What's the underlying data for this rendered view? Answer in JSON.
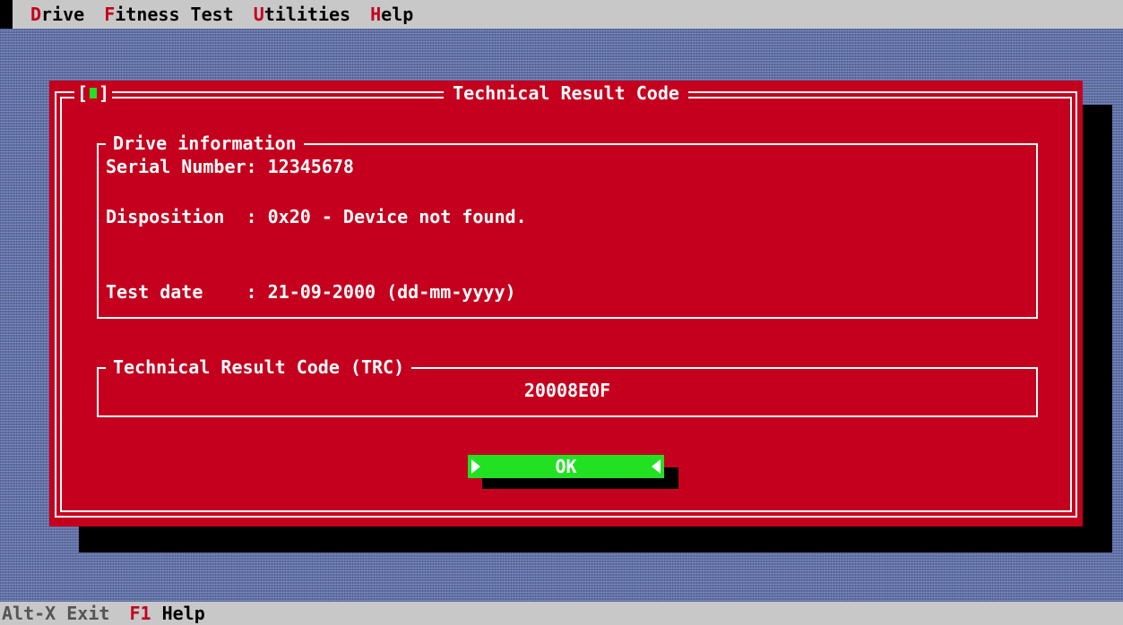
{
  "menu": {
    "items": [
      {
        "hot": "D",
        "rest": "rive"
      },
      {
        "hot": "F",
        "rest": "itness Test"
      },
      {
        "hot": "U",
        "rest": "tilities"
      },
      {
        "hot": "H",
        "rest": "elp"
      }
    ]
  },
  "dialog": {
    "title": "Technical Result Code",
    "close_left": "[",
    "close_right": "]",
    "drive_info": {
      "label": "Drive information",
      "serial": "Serial Number: 12345678",
      "disposition": "Disposition  : 0x20 - Device not found.",
      "test_date": "Test date    : 21-09-2000 (dd-mm-yyyy)"
    },
    "trc": {
      "label": "Technical Result Code (TRC)",
      "value": "20008E0F"
    },
    "ok_label": "OK"
  },
  "status": {
    "exit_key": "Alt-X",
    "exit_text": "Exit",
    "help_key": "F1",
    "help_text": "Help"
  },
  "colors": {
    "dialog_bg": "#c4001e",
    "accent_green": "#22e022",
    "bar_gray": "#c8c8c8",
    "desktop": "#5f6fa8"
  }
}
